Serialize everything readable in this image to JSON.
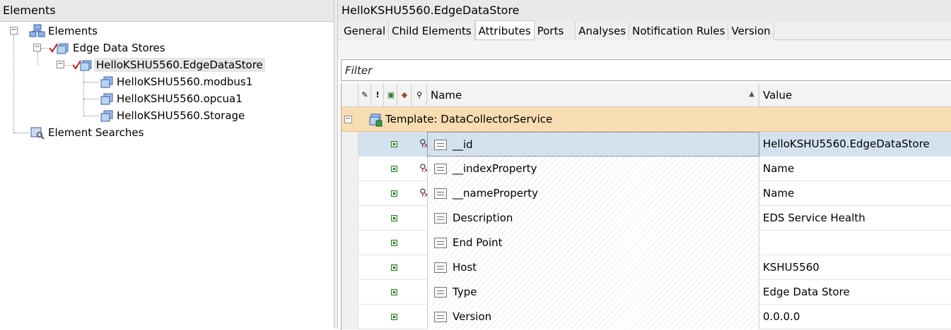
{
  "left_pane": {
    "header": "Elements",
    "tree": [
      {
        "label": "Elements",
        "icon": "elements-root-icon"
      },
      {
        "label": "Edge Data Stores",
        "icon": "checked-element-icon"
      },
      {
        "label": "HelloKSHU5560.EdgeDataStore",
        "icon": "checked-element-icon"
      },
      {
        "label": "HelloKSHU5560.modbus1",
        "icon": "element-icon"
      },
      {
        "label": "HelloKSHU5560.opcua1",
        "icon": "element-icon"
      },
      {
        "label": "HelloKSHU5560.Storage",
        "icon": "element-icon"
      },
      {
        "label": "Element Searches",
        "icon": "element-search-icon"
      }
    ]
  },
  "right_pane": {
    "title": "HelloKSHU5560.EdgeDataStore",
    "tabs": [
      "General",
      "Child Elements",
      "Attributes",
      "Ports",
      "Analyses",
      "Notification Rules",
      "Version"
    ],
    "active_tab": "Attributes",
    "filter_placeholder": "Filter",
    "columns": {
      "name": "Name",
      "value": "Value"
    },
    "template_group": "Template: DataCollectorService",
    "rows": [
      {
        "name": "__id",
        "value": "HelloKSHU5560.EdgeDataStore",
        "excluded": true
      },
      {
        "name": "__indexProperty",
        "value": "Name",
        "excluded": true
      },
      {
        "name": "__nameProperty",
        "value": "Name",
        "excluded": true
      },
      {
        "name": "Description",
        "value": "EDS Service Health",
        "excluded": false
      },
      {
        "name": "End Point",
        "value": "",
        "excluded": false
      },
      {
        "name": "Host",
        "value": "KSHU5560",
        "excluded": false
      },
      {
        "name": "Type",
        "value": "Edge Data Store",
        "excluded": false
      },
      {
        "name": "Version",
        "value": "0.0.0.0",
        "excluded": false
      }
    ]
  }
}
